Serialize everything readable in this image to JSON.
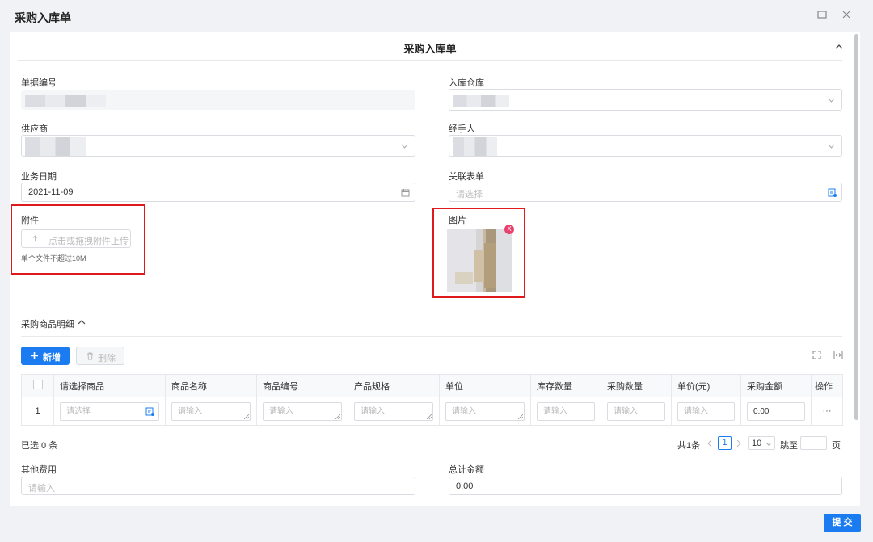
{
  "window": {
    "title": "采购入库单",
    "maximize_icon": "maximize-icon",
    "close_icon": "close-icon"
  },
  "form": {
    "section_title": "采购入库单",
    "fields": {
      "doc_no": {
        "label": "单据编号"
      },
      "warehouse": {
        "label": "入库仓库"
      },
      "supplier": {
        "label": "供应商"
      },
      "handler": {
        "label": "经手人"
      },
      "biz_date": {
        "label": "业务日期",
        "value": "2021-11-09"
      },
      "related_doc": {
        "label": "关联表单",
        "placeholder": "请选择"
      },
      "attachment": {
        "label": "附件",
        "button": "点击或拖拽附件上传",
        "hint": "单个文件不超过10M"
      },
      "image": {
        "label": "图片",
        "remove_label": "X"
      }
    }
  },
  "detail": {
    "title": "采购商品明细",
    "add_button": "新增",
    "delete_button": "删除",
    "columns": [
      "请选择商品",
      "商品名称",
      "商品编号",
      "产品规格",
      "单位",
      "库存数量",
      "采购数量",
      "单价(元)",
      "采购金额",
      "操作"
    ],
    "row": {
      "index": "1",
      "product_placeholder": "请选择",
      "name_placeholder": "请输入",
      "code_placeholder": "请输入",
      "spec_placeholder": "请输入",
      "unit_placeholder": "请输入",
      "stock_placeholder": "请输入",
      "qty_placeholder": "请输入",
      "price_placeholder": "请输入",
      "amount_value": "0.00",
      "action": "···"
    }
  },
  "footer": {
    "selected": "已选 0 条",
    "total": "共1条",
    "current_page": "1",
    "page_size": "10",
    "jump_label": "跳至",
    "page_unit": "页"
  },
  "other_fees": {
    "label": "其他费用",
    "placeholder": "请输入"
  },
  "total_amount": {
    "label": "总计金额",
    "value": "0.00"
  },
  "submit_button": "提 交",
  "colors": {
    "primary": "#1a7cf0",
    "highlight": "#e0191c",
    "remove": "#e8406e"
  }
}
